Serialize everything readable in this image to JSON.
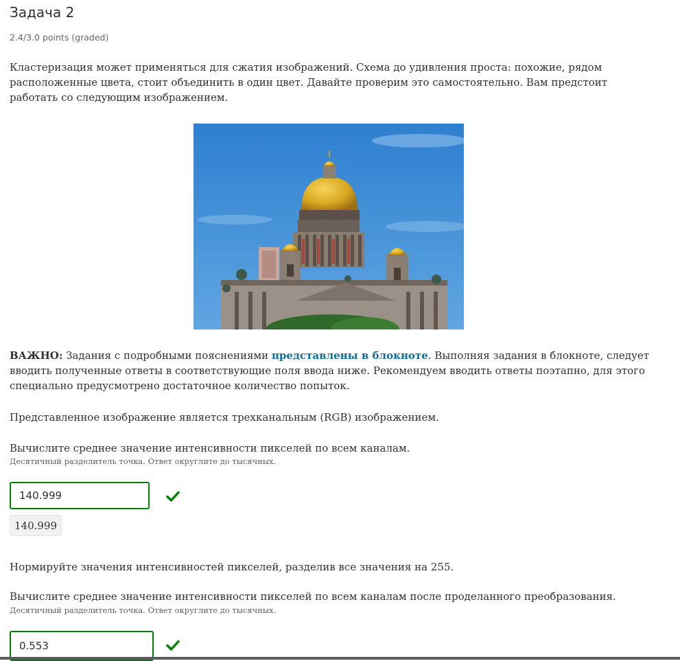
{
  "problem": {
    "title": "Задача 2",
    "points": "2.4/3.0 points (graded)"
  },
  "intro": "Кластеризация может применяться для сжатия изображений. Схема до удивления проста: похожие, рядом расположенные цвета, стоит объединить в один цвет. Давайте проверим это самостоятельно. Вам предстоит работать со следующим изображением.",
  "important": {
    "label": "ВАЖНО:",
    "text_before": " Задания с подробными пояснениями ",
    "link_text": "представлены в блокноте",
    "text_after": ". Выполняя задания в блокноте, следует вводить полученные ответы в соответствующие поля ввода ниже. Рекомендуем вводить ответы поэтапно, для этого специально предусмотрено достаточное количество попыток."
  },
  "rgb_note": "Представленное изображение является трехканальным (RGB) изображением.",
  "question1": {
    "prompt": "Вычислите среднее значение интенсивности пикселей по всем каналам.",
    "hint": "Десятичный разделитель точка. Ответ округлите до тысячных.",
    "value": "140.999",
    "echo": "140.999",
    "status_icon": "check-icon"
  },
  "normalize_note": "Нормируйте значения интенсивностей пикселей, разделив все значения на 255.",
  "question2": {
    "prompt": "Вычислите среднее значение интенсивности пикселей по всем каналам после проделанного преобразования.",
    "hint": "Десятичный разделитель точка. Ответ округлите до тысячных.",
    "value": "0.553",
    "status_icon": "check-icon"
  },
  "colors": {
    "correct": "#008100",
    "link": "#0b6f9e",
    "sky": "#3f8fd6",
    "gold": "#d9a821"
  }
}
